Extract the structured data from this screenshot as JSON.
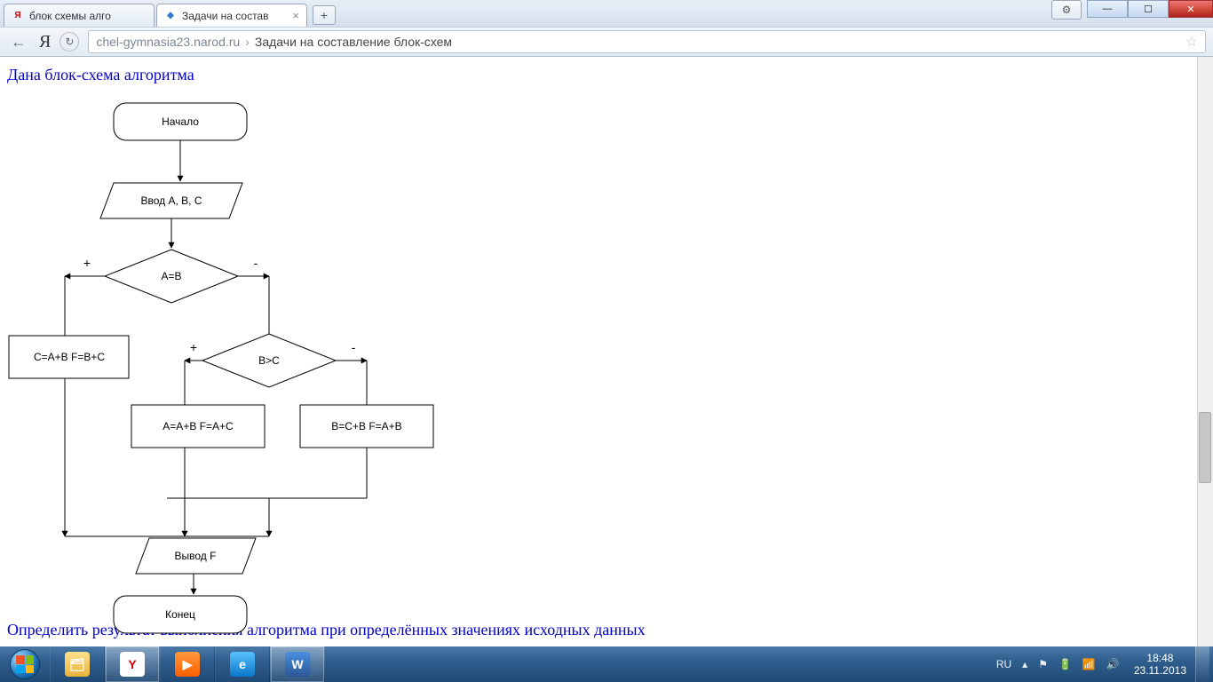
{
  "tabs": [
    {
      "title": "блок схемы алго",
      "favicon_color": "#cc0000",
      "favicon_text": "Я",
      "active": false
    },
    {
      "title": "Задачи на состав",
      "favicon_color": "#3a7bd5",
      "favicon_text": "◆",
      "active": true
    }
  ],
  "addr": {
    "host": "chel-gymnasia23.narod.ru",
    "title": "Задачи на составление блок-схем"
  },
  "page": {
    "heading1": "Дана блок-схема алгоритма",
    "heading2": "Определить результат выполнения алгоритма при определённых значениях исходных данных"
  },
  "flowchart": {
    "start": "Начало",
    "input": "Ввод A, B, C",
    "cond1": "A=B",
    "cond2": "B>C",
    "plus": "+",
    "minus": "-",
    "box_left": "C=A+B      F=B+C",
    "box_mid": "A=A+B    F=A+C",
    "box_right": "B=C+B     F=A+B",
    "output": "Вывод F",
    "end": "Конец"
  },
  "tray": {
    "lang": "RU",
    "time": "18:48",
    "date": "23.11.2013"
  }
}
